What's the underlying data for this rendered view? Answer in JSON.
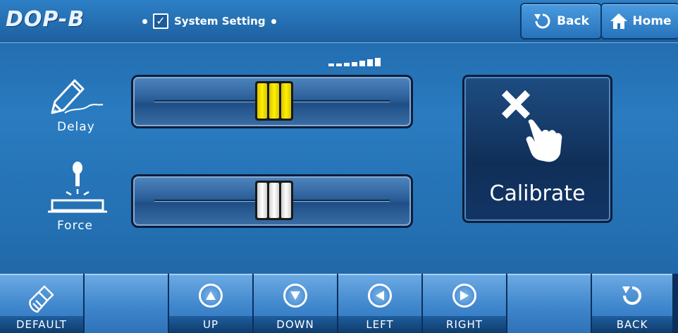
{
  "header": {
    "logo": "DOP-B",
    "breadcrumb_check": "✓",
    "breadcrumb_title": "System Setting",
    "back_label": "Back",
    "home_label": "Home"
  },
  "settings": {
    "delay_label": "Delay",
    "force_label": "Force",
    "delay_level": 0.51,
    "force_level": 0.51
  },
  "calibrate": {
    "label": "Calibrate"
  },
  "function_keys": [
    {
      "label": "DEFAULT",
      "icon": "brush-icon"
    },
    {
      "label": "",
      "icon": ""
    },
    {
      "label": "UP",
      "icon": "arrow-up-icon"
    },
    {
      "label": "DOWN",
      "icon": "arrow-down-icon"
    },
    {
      "label": "LEFT",
      "icon": "arrow-left-icon"
    },
    {
      "label": "RIGHT",
      "icon": "arrow-right-icon"
    },
    {
      "label": "",
      "icon": ""
    },
    {
      "label": "BACK",
      "icon": "back-icon"
    }
  ],
  "colors": {
    "background": "#2a7bc0",
    "accent_yellow": "#fff000",
    "button_dark": "#102f58"
  }
}
